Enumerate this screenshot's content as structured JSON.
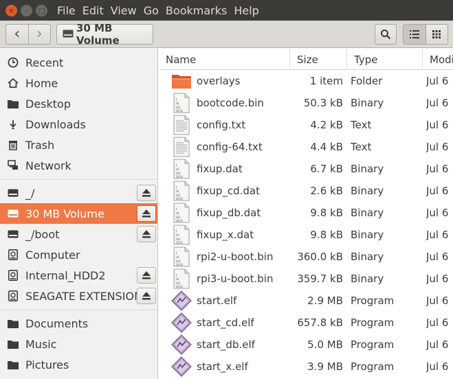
{
  "menubar": {
    "items": [
      "File",
      "Edit",
      "View",
      "Go",
      "Bookmarks",
      "Help"
    ],
    "close_glyph": "×",
    "min_glyph": "–",
    "max_glyph": "□"
  },
  "toolbar": {
    "back_glyph": "‹",
    "forward_glyph": "›",
    "location_label": "30 MB Volume"
  },
  "sidebar": {
    "items": [
      {
        "label": "Recent",
        "icon": "clock-icon"
      },
      {
        "label": "Home",
        "icon": "home-icon"
      },
      {
        "label": "Desktop",
        "icon": "folder-icon"
      },
      {
        "label": "Downloads",
        "icon": "download-icon"
      },
      {
        "label": "Trash",
        "icon": "trash-icon"
      },
      {
        "label": "Network",
        "icon": "network-icon"
      },
      {
        "label": "_/",
        "icon": "drive-icon",
        "eject": true
      },
      {
        "label": "30 MB Volume",
        "icon": "drive-icon",
        "eject": true,
        "selected": true
      },
      {
        "label": "_/boot",
        "icon": "drive-icon",
        "eject": true
      },
      {
        "label": "Computer",
        "icon": "harddisk-icon"
      },
      {
        "label": "Internal_HDD2",
        "icon": "harddisk-icon",
        "eject": true
      },
      {
        "label": "SEAGATE EXTENSION",
        "icon": "harddisk-icon",
        "eject": true
      },
      {
        "label": "Documents",
        "icon": "folder-icon"
      },
      {
        "label": "Music",
        "icon": "folder-icon"
      },
      {
        "label": "Pictures",
        "icon": "folder-icon"
      }
    ]
  },
  "columns": {
    "name": "Name",
    "size": "Size",
    "type": "Type",
    "modified": "Modifi"
  },
  "files": [
    {
      "name": "overlays",
      "size": "1 item",
      "type": "Folder",
      "modified": "Jul 6",
      "icon": "folder"
    },
    {
      "name": "bootcode.bin",
      "size": "50.3 kB",
      "type": "Binary",
      "modified": "Jul 6",
      "icon": "binary"
    },
    {
      "name": "config.txt",
      "size": "4.2 kB",
      "type": "Text",
      "modified": "Jul 6",
      "icon": "text"
    },
    {
      "name": "config-64.txt",
      "size": "4.4 kB",
      "type": "Text",
      "modified": "Jul 6",
      "icon": "text"
    },
    {
      "name": "fixup.dat",
      "size": "6.7 kB",
      "type": "Binary",
      "modified": "Jul 6",
      "icon": "binary"
    },
    {
      "name": "fixup_cd.dat",
      "size": "2.6 kB",
      "type": "Binary",
      "modified": "Jul 6",
      "icon": "binary"
    },
    {
      "name": "fixup_db.dat",
      "size": "9.8 kB",
      "type": "Binary",
      "modified": "Jul 6",
      "icon": "binary"
    },
    {
      "name": "fixup_x.dat",
      "size": "9.8 kB",
      "type": "Binary",
      "modified": "Jul 6",
      "icon": "binary"
    },
    {
      "name": "rpi2-u-boot.bin",
      "size": "360.0 kB",
      "type": "Binary",
      "modified": "Jul 6",
      "icon": "binary"
    },
    {
      "name": "rpi3-u-boot.bin",
      "size": "359.7 kB",
      "type": "Binary",
      "modified": "Jul 6",
      "icon": "binary"
    },
    {
      "name": "start.elf",
      "size": "2.9 MB",
      "type": "Program",
      "modified": "Jul 6",
      "icon": "program"
    },
    {
      "name": "start_cd.elf",
      "size": "657.8 kB",
      "type": "Program",
      "modified": "Jul 6",
      "icon": "program"
    },
    {
      "name": "start_db.elf",
      "size": "5.0 MB",
      "type": "Program",
      "modified": "Jul 6",
      "icon": "program"
    },
    {
      "name": "start_x.elf",
      "size": "3.9 MB",
      "type": "Program",
      "modified": "Jul 6",
      "icon": "program"
    }
  ],
  "colors": {
    "accent": "#f07746",
    "menubar_bg": "#3c3b37",
    "folder_orange": "#e8622c"
  }
}
